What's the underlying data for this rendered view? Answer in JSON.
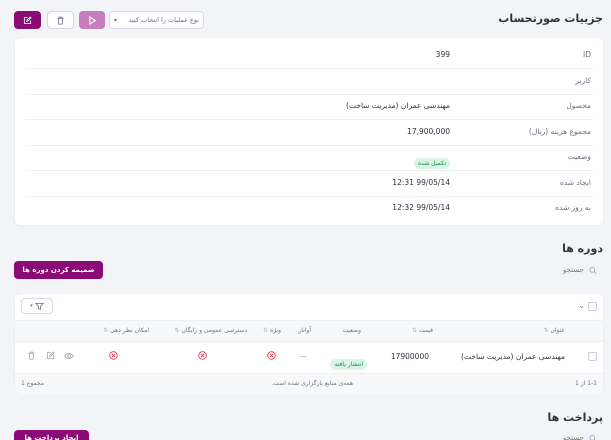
{
  "invoice": {
    "title": "جزییات صورتحساب",
    "operations_placeholder": "نوع عملیات را انتخاب کنید",
    "fields": [
      {
        "label": "ID",
        "value": "399"
      },
      {
        "label": "کاربر",
        "value": ""
      },
      {
        "label": "محصول",
        "value": "مهندسی عمران (مدیریت ساخت)"
      },
      {
        "label": "مجموع هزینه (ریال)",
        "value": "17,900,000"
      },
      {
        "label": "وضعیت",
        "value": "تکمیل شده"
      },
      {
        "label": "ایجاد شده",
        "value": "99/05/14 12:31"
      },
      {
        "label": "به روز شده",
        "value": "99/05/14 12:32"
      }
    ]
  },
  "courses": {
    "title": "دوره ها",
    "attach_button": "ضمیمه کردن دوره ها",
    "search_placeholder": "جستجو",
    "columns": {
      "title": "عنوان",
      "price": "قیمت",
      "status": "وضعیت",
      "avatar": "آواتار",
      "special": "ویژه",
      "public_access": "دسترسی عمومی و رایگان",
      "rating": "امکان نظر دهی"
    },
    "rows": [
      {
        "title": "مهندسی عمران (مدیریت ساخت)",
        "price": "17900000",
        "status": "انتشار یافته",
        "avatar": "—"
      }
    ],
    "footer": {
      "range": "1-1 از 1",
      "message": "همه‌ی منابع بارگزاری شده است.",
      "total": "مجموع 1"
    }
  },
  "payments": {
    "title": "پرداخت ها",
    "create_button": "ایجاد پرداخت ها",
    "search_placeholder": "جستجو"
  },
  "colors": {
    "primary": "#8a0a76",
    "primary_light": "#c77dbb",
    "success": "#1c8a4a",
    "danger": "#e53950"
  }
}
